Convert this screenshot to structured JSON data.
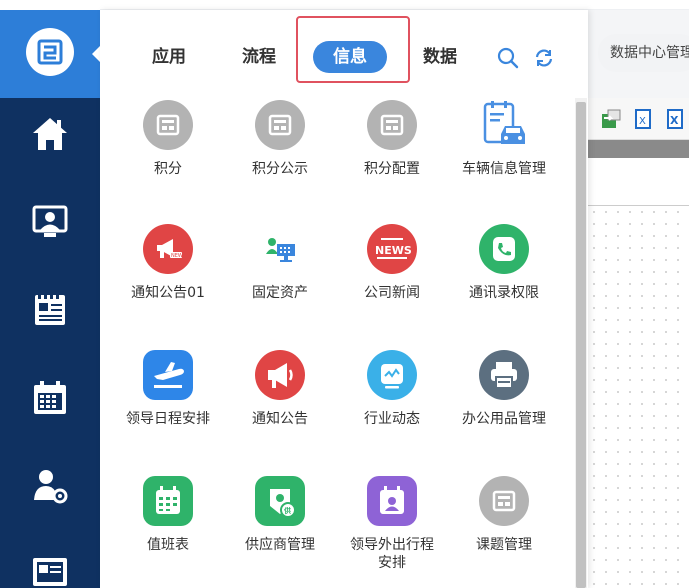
{
  "tabs": [
    {
      "label": "应用",
      "active": false
    },
    {
      "label": "流程",
      "active": false
    },
    {
      "label": "信息",
      "active": true
    },
    {
      "label": "数据",
      "active": false
    }
  ],
  "header_search_text": "数据中心管理",
  "apps": [
    {
      "label": "积分",
      "icon": "generic-grey-icon"
    },
    {
      "label": "积分公示",
      "icon": "generic-grey-icon"
    },
    {
      "label": "积分配置",
      "icon": "generic-grey-icon"
    },
    {
      "label": "车辆信息管理",
      "icon": "vehicle-info-icon"
    },
    {
      "label": "通知公告01",
      "icon": "megaphone-new-icon"
    },
    {
      "label": "固定资产",
      "icon": "fixed-asset-icon"
    },
    {
      "label": "公司新闻",
      "icon": "news-icon"
    },
    {
      "label": "通讯录权限",
      "icon": "phone-book-icon"
    },
    {
      "label": "领导日程安排",
      "icon": "plane-schedule-icon"
    },
    {
      "label": "通知公告",
      "icon": "megaphone-icon"
    },
    {
      "label": "行业动态",
      "icon": "trend-icon"
    },
    {
      "label": "办公用品管理",
      "icon": "printer-icon"
    },
    {
      "label": "值班表",
      "icon": "duty-calendar-icon"
    },
    {
      "label": "供应商管理",
      "icon": "supplier-icon"
    },
    {
      "label": "领导外出行程安排",
      "icon": "travel-icon"
    },
    {
      "label": "课题管理",
      "icon": "generic-grey-icon"
    }
  ],
  "colors": {
    "sidebar": "#0f3161",
    "sidebar_active": "#2d7ed8",
    "tab_active": "#3a86dd",
    "highlight_border": "#e0525f"
  }
}
